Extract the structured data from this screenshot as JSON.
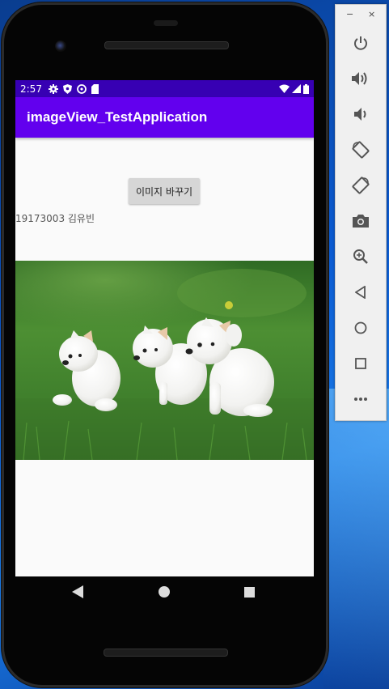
{
  "status_bar": {
    "time": "2:57"
  },
  "app_bar": {
    "title": "imageView_TestApplication"
  },
  "main": {
    "change_button_label": "이미지 바꾸기",
    "student_text": "19173003 김유빈"
  },
  "toolbar": {
    "minimize_label": "−",
    "close_label": "×",
    "buttons": [
      "power-icon",
      "volume-up-icon",
      "volume-down-icon",
      "rotate-left-icon",
      "rotate-right-icon",
      "camera-icon",
      "zoom-icon",
      "back-icon",
      "home-icon",
      "overview-icon",
      "more-icon"
    ]
  },
  "colors": {
    "status_bar": "#3700b3",
    "app_bar": "#6200ee",
    "screen_bg": "#fafafa",
    "button_bg": "#d6d6d6"
  }
}
